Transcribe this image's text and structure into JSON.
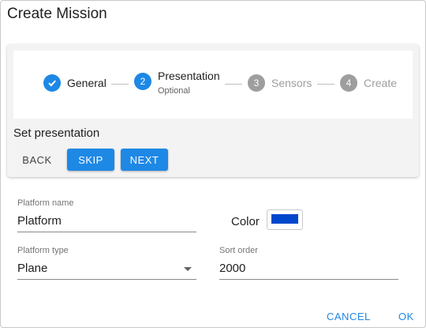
{
  "dialog": {
    "title": "Create Mission"
  },
  "stepper": {
    "steps": [
      {
        "number": "",
        "label": "General",
        "state": "completed"
      },
      {
        "number": "2",
        "label": "Presentation",
        "sub": "Optional",
        "state": "active"
      },
      {
        "number": "3",
        "label": "Sensors",
        "state": "inactive"
      },
      {
        "number": "4",
        "label": "Create",
        "state": "inactive"
      }
    ],
    "content_label": "Set presentation",
    "back_label": "BACK",
    "skip_label": "SKIP",
    "next_label": "NEXT"
  },
  "form": {
    "platform_name": {
      "label": "Platform name",
      "value": "Platform"
    },
    "color": {
      "label": "Color",
      "value": "#0047cc"
    },
    "platform_type": {
      "label": "Platform type",
      "value": "Plane"
    },
    "sort_order": {
      "label": "Sort order",
      "value": "2000"
    }
  },
  "actions": {
    "cancel_label": "CANCEL",
    "ok_label": "OK"
  },
  "colors": {
    "accent": "#1e88e5",
    "inactive": "#9e9e9e",
    "swatch": "#0047cc"
  }
}
